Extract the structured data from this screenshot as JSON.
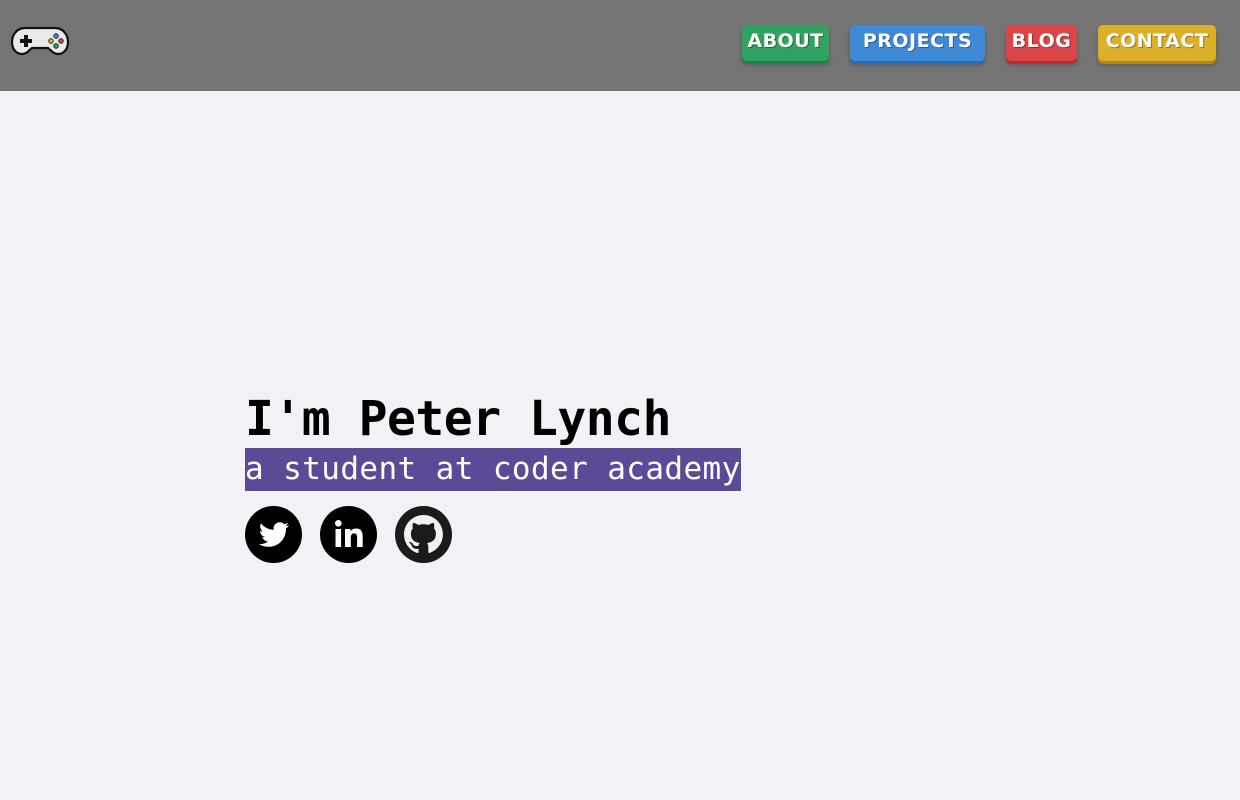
{
  "header": {
    "logo_icon": "gamepad-icon",
    "nav": [
      {
        "label": "ABOUT",
        "color": "#2fa35f"
      },
      {
        "label": "PROJECTS",
        "color": "#3e8ad6"
      },
      {
        "label": "BLOG",
        "color": "#dc4547"
      },
      {
        "label": "CONTACT",
        "color": "#ddb02a"
      }
    ]
  },
  "hero": {
    "name": "I'm Peter Lynch",
    "tagline": "a student at coder academy",
    "tagline_bg": "#5c4a96"
  },
  "socials": [
    {
      "icon": "twitter-icon"
    },
    {
      "icon": "linkedin-icon"
    },
    {
      "icon": "github-icon"
    }
  ]
}
